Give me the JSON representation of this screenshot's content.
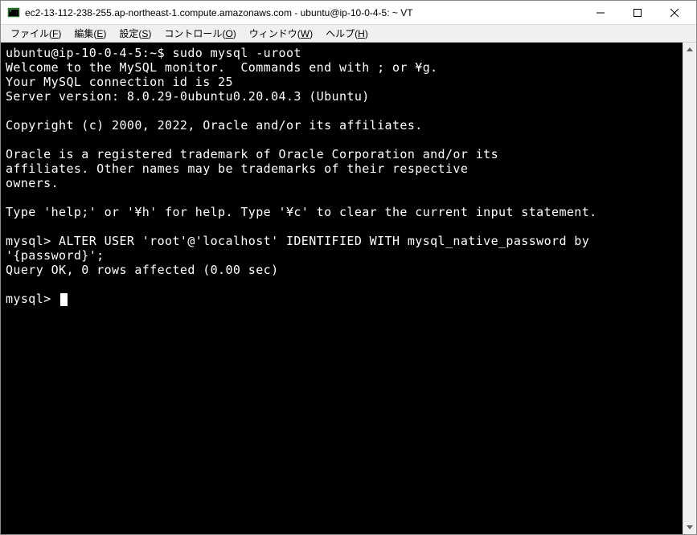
{
  "window": {
    "title": "ec2-13-112-238-255.ap-northeast-1.compute.amazonaws.com - ubuntu@ip-10-0-4-5: ~ VT"
  },
  "menu": {
    "file": {
      "label": "ファイル",
      "accel": "F"
    },
    "edit": {
      "label": "編集",
      "accel": "E"
    },
    "settings": {
      "label": "設定",
      "accel": "S"
    },
    "control": {
      "label": "コントロール",
      "accel": "O"
    },
    "window": {
      "label": "ウィンドウ",
      "accel": "W"
    },
    "help": {
      "label": "ヘルプ",
      "accel": "H"
    }
  },
  "terminal": {
    "lines": [
      "ubuntu@ip-10-0-4-5:~$ sudo mysql -uroot",
      "Welcome to the MySQL monitor.  Commands end with ; or ¥g.",
      "Your MySQL connection id is 25",
      "Server version: 8.0.29-0ubuntu0.20.04.3 (Ubuntu)",
      "",
      "Copyright (c) 2000, 2022, Oracle and/or its affiliates.",
      "",
      "Oracle is a registered trademark of Oracle Corporation and/or its",
      "affiliates. Other names may be trademarks of their respective",
      "owners.",
      "",
      "Type 'help;' or '¥h' for help. Type '¥c' to clear the current input statement.",
      "",
      "mysql> ALTER USER 'root'@'localhost' IDENTIFIED WITH mysql_native_password by '{password}';",
      "Query OK, 0 rows affected (0.00 sec)",
      "",
      "mysql> "
    ]
  }
}
